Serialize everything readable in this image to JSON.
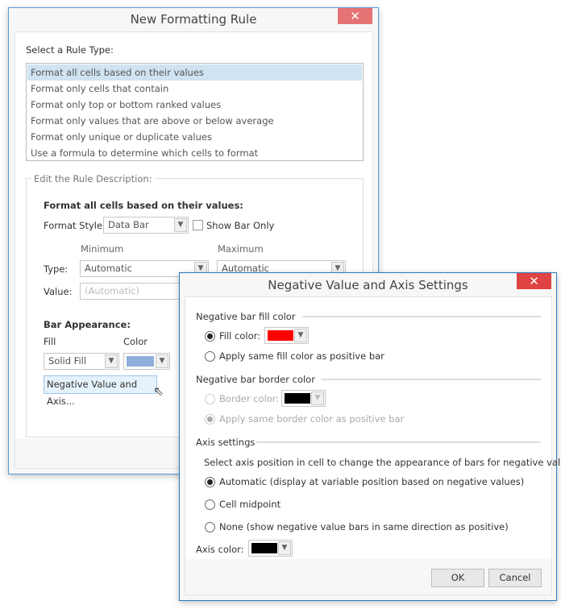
{
  "back": {
    "title": "New Formatting Rule",
    "select_label": "Select a Rule Type:",
    "rule_types": [
      "Format all cells based on their values",
      "Format only cells that contain",
      "Format only top or bottom ranked values",
      "Format only values that are above or below average",
      "Format only unique or duplicate values",
      "Use a formula to determine which cells to format"
    ],
    "selected_index": 0,
    "group_title": "Edit the Rule Description:",
    "heading": "Format all cells based on their values:",
    "format_style_label": "Format Style:",
    "format_style_value": "Data Bar",
    "show_bar_only": "Show Bar Only",
    "show_bar_only_checked": false,
    "minimum": "Minimum",
    "maximum": "Maximum",
    "type_label": "Type:",
    "min_type": "Automatic",
    "max_type": "Automatic",
    "value_label": "Value:",
    "min_value_placeholder": "(Automatic)",
    "bar_appearance": "Bar Appearance:",
    "fill_label": "Fill",
    "color_label": "Color",
    "fill_value": "Solid Fill",
    "bar_color": "#8eaedb",
    "negative_button": "Negative Value and Axis..."
  },
  "front": {
    "title": "Negative Value and Axis Settings",
    "fill_section": "Negative bar fill color",
    "fill_color_label": "Fill color:",
    "fill_color": "#ff0000",
    "fill_same": "Apply same fill color as positive bar",
    "border_section": "Negative bar border color",
    "border_color_label": "Border color:",
    "border_color": "#000000",
    "border_same": "Apply same border color as positive bar",
    "axis_section": "Axis settings",
    "axis_hint": "Select axis position in cell to change the appearance of bars for negative values",
    "axis_options": [
      "Automatic (display at variable position based on negative values)",
      "Cell midpoint",
      "None (show negative value bars in same direction as positive)"
    ],
    "axis_selected": 0,
    "axis_color_label": "Axis color:",
    "axis_color": "#000000",
    "ok": "OK",
    "cancel": "Cancel"
  }
}
